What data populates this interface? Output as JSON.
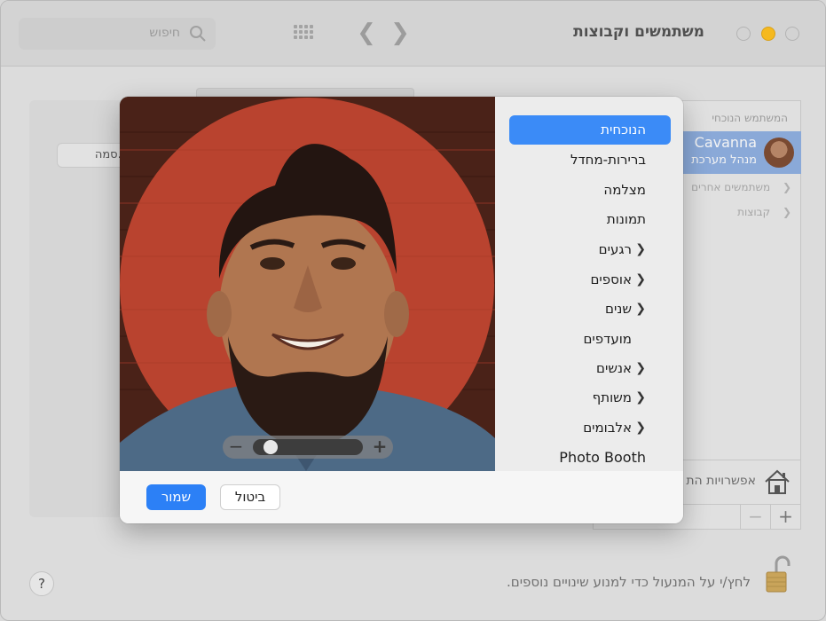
{
  "window": {
    "title": "משתמשים וקבוצות",
    "search_placeholder": "חיפוש"
  },
  "background": {
    "name_button": "...סמה",
    "users_heading": "המשתמש הנוכחי",
    "current_user": {
      "name": "Cavanna",
      "role": "מנהל מערכת"
    },
    "rows": [
      {
        "label": "משתמשים אחרים"
      },
      {
        "label": "קבוצות"
      }
    ],
    "login_options": "אפשרויות הת",
    "add": "+",
    "remove": "−",
    "lock_text": "לחץ/י על המנעול כדי למנוע שינויים נוספים.",
    "help": "?"
  },
  "sheet": {
    "sidebar": [
      {
        "label": "הנוכחית",
        "selected": true,
        "chevron": false
      },
      {
        "label": "ברירות-מחדל",
        "selected": false,
        "chevron": false
      },
      {
        "label": "מצלמה",
        "selected": false,
        "chevron": false
      },
      {
        "label": "תמונות",
        "selected": false,
        "chevron": false
      },
      {
        "label": "רגעים",
        "selected": false,
        "chevron": true
      },
      {
        "label": "אוספים",
        "selected": false,
        "chevron": true
      },
      {
        "label": "שנים",
        "selected": false,
        "chevron": true
      },
      {
        "label": "מועדפים",
        "selected": false,
        "chevron": false
      },
      {
        "label": "אנשים",
        "selected": false,
        "chevron": true
      },
      {
        "label": "משותף",
        "selected": false,
        "chevron": true
      },
      {
        "label": "אלבומים",
        "selected": false,
        "chevron": true
      },
      {
        "label": "Photo Booth",
        "selected": false,
        "chevron": false
      }
    ],
    "zoom": {
      "minus": "−",
      "plus": "+",
      "level": 0.1
    },
    "cancel_label": "ביטול",
    "save_label": "שמור"
  },
  "colors": {
    "accent": "#2c80f6",
    "selection": "#3b8bf7",
    "minimize": "#f5b91f",
    "photo_bg": "#b9432f"
  }
}
